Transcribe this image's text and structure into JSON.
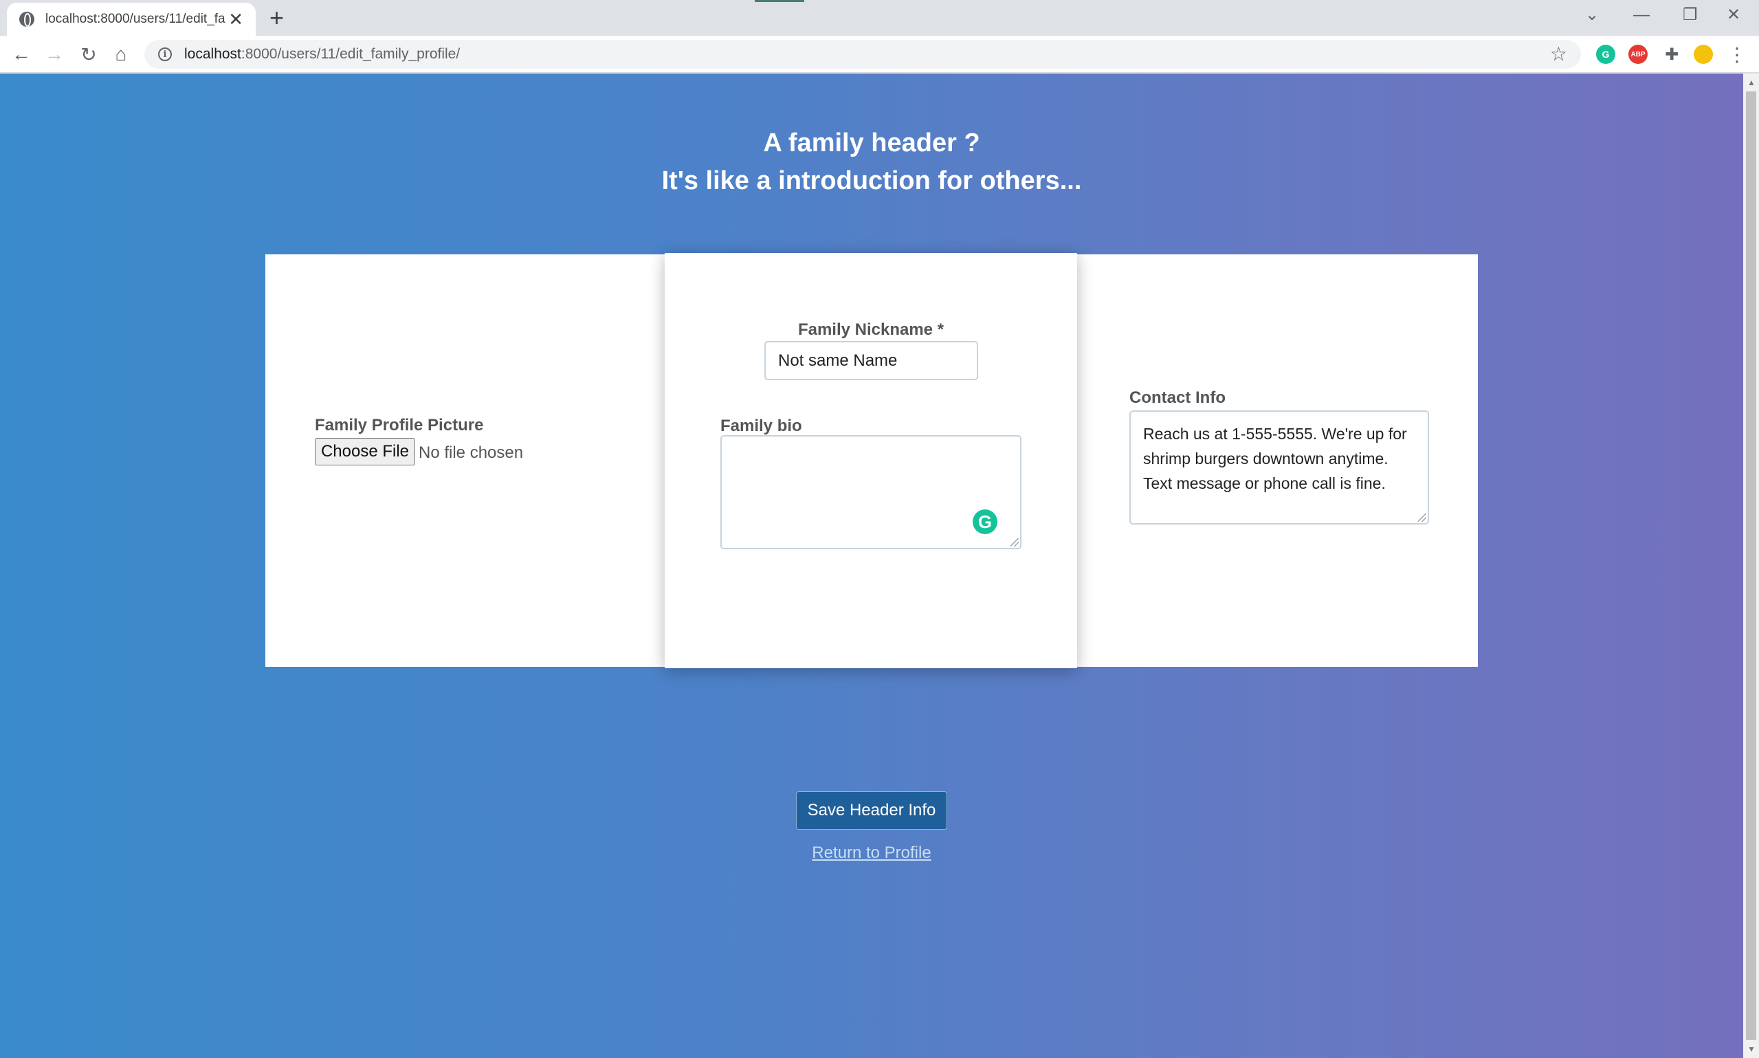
{
  "browser": {
    "tab_title": "localhost:8000/users/11/edit_fam",
    "url_host": "localhost",
    "url_rest": ":8000/users/11/edit_family_profile/",
    "extensions": [
      {
        "name": "grammarly-extension-icon",
        "label": "G",
        "color": "#15c39a"
      },
      {
        "name": "adblock-extension-icon",
        "label": "ABP",
        "color": "#e53935"
      }
    ]
  },
  "page": {
    "heading_line1": "A family header ?",
    "heading_line2": "It's like a introduction for others...",
    "picture_label": "Family Profile Picture",
    "choose_file_label": "Choose File",
    "file_status": "No file chosen",
    "nickname_label": "Family Nickname *",
    "nickname_value": "Not same Name",
    "bio_label": "Family bio",
    "bio_value": "",
    "contact_label": "Contact Info",
    "contact_value": "Reach us at 1-555-5555. We're up for shrimp burgers downtown anytime. Text message or phone call is fine.",
    "save_button": "Save Header Info",
    "return_link": "Return to Profile"
  }
}
